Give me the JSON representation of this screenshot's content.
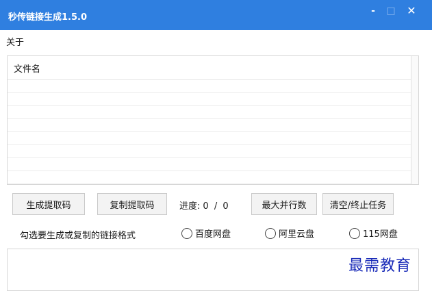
{
  "window": {
    "title": "秒传链接生成1.5.0",
    "controls": {
      "minimize": "-",
      "maximize": "□",
      "close": "✕"
    }
  },
  "menu": {
    "about": "关于"
  },
  "file_list": {
    "column_header": "文件名",
    "rows": [
      "",
      "",
      "",
      "",
      "",
      "",
      "",
      ""
    ]
  },
  "actions": {
    "generate_label": "生成提取码",
    "copy_label": "复制提取码",
    "max_parallel_label": "最大并行数",
    "clear_label": "清空/终止任务"
  },
  "progress": {
    "label": "进度:",
    "current": "0",
    "separator": "/",
    "total": "0"
  },
  "link_format": {
    "label": "勾选要生成或复制的链接格式",
    "options": [
      {
        "label": "百度网盘",
        "checked": false
      },
      {
        "label": "阿里云盘",
        "checked": false
      },
      {
        "label": "115网盘",
        "checked": false
      }
    ]
  },
  "watermark": "最需教育",
  "colors": {
    "titlebar": "#2f7fe0",
    "watermark": "#1a2bb8"
  }
}
